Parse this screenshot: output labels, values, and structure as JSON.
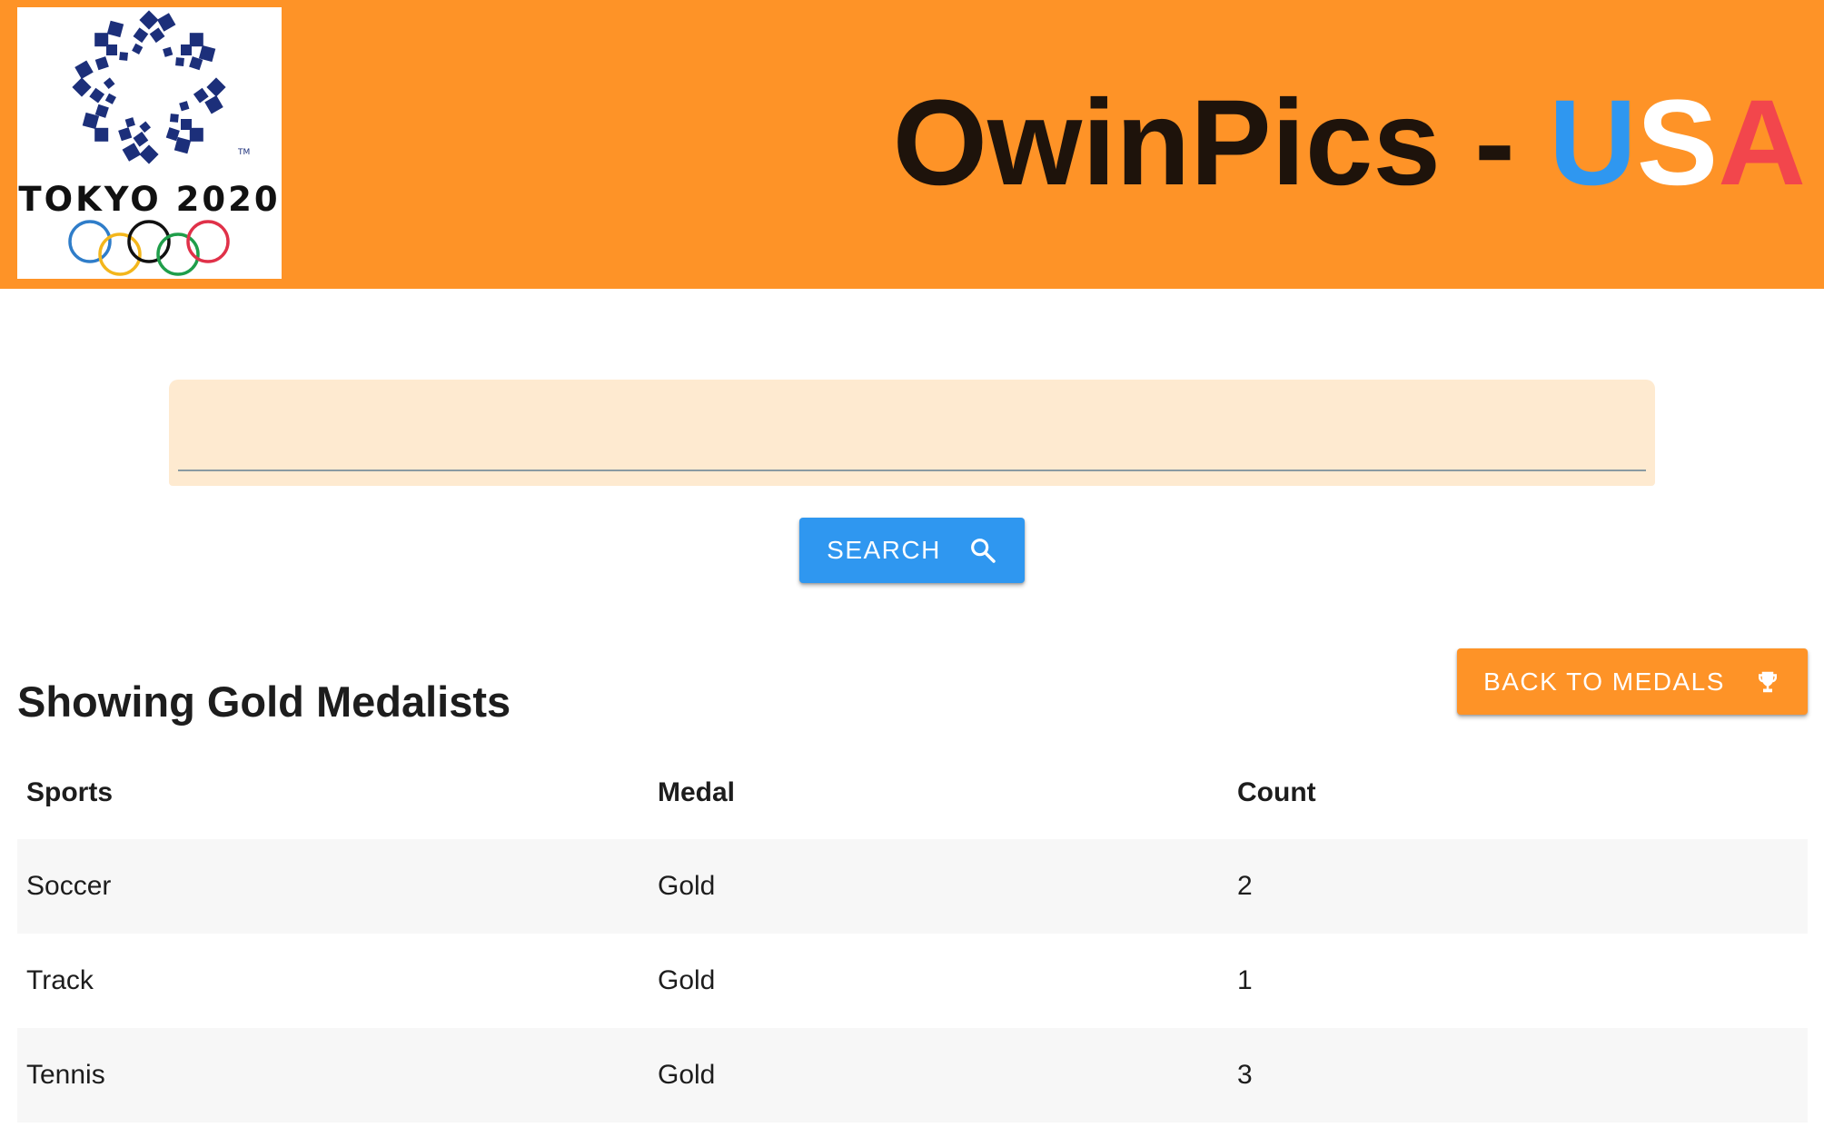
{
  "header": {
    "logo": {
      "text": "TOKYO 2020",
      "trademark": "TM",
      "ring_colors": [
        "#2f7dc9",
        "#f3b61c",
        "#111111",
        "#1f9e4a",
        "#e03149"
      ],
      "emblem_color": "#1c2f7a"
    },
    "title": {
      "main": "OwinPics - ",
      "letter_u": "U",
      "letter_s": "S",
      "letter_a": "A"
    },
    "colors": {
      "background": "#fe9327",
      "u": "#2f97f0",
      "s": "#ffffff",
      "a": "#f2464c"
    }
  },
  "search": {
    "value": "",
    "placeholder": "",
    "button_label": "SEARCH",
    "button_icon": "search-icon",
    "colors": {
      "field": "#feead0",
      "button": "#2f97f0"
    }
  },
  "results": {
    "heading": "Showing Gold Medalists",
    "back_button_label": "BACK TO MEDALS",
    "back_button_icon": "trophy-icon",
    "columns": [
      "Sports",
      "Medal",
      "Count"
    ],
    "rows": [
      [
        "Soccer",
        "Gold",
        "2"
      ],
      [
        "Track",
        "Gold",
        "1"
      ],
      [
        "Tennis",
        "Gold",
        "3"
      ]
    ]
  }
}
